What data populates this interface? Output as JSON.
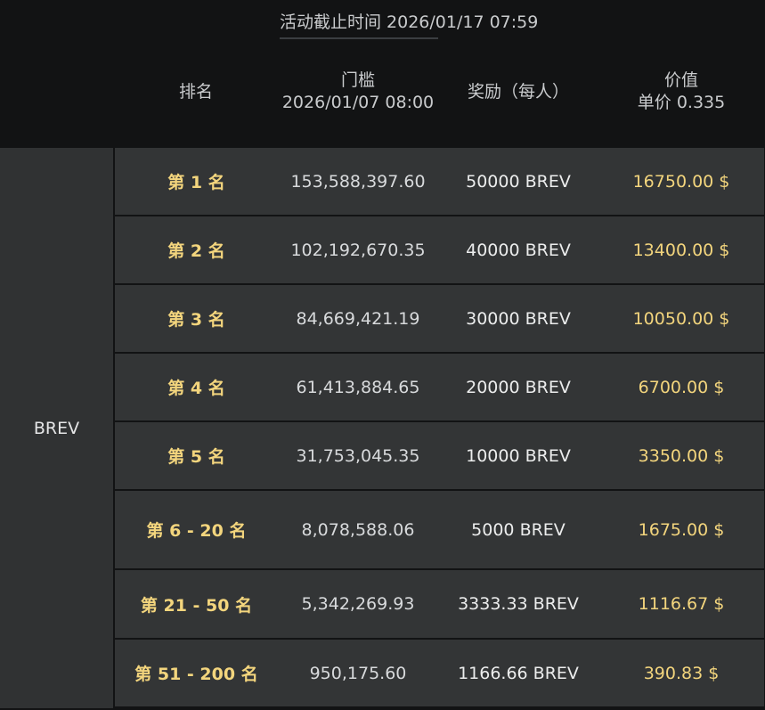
{
  "header": {
    "deadline": "活动截止时间 2026/01/17 07:59",
    "columns": {
      "rank": "排名",
      "threshold_line1": "门槛",
      "threshold_line2": "2026/01/07 08:00",
      "reward": "奖励（每人）",
      "value_line1": "价值",
      "value_line2": "单价 0.335"
    }
  },
  "token": "BREV",
  "rows": [
    {
      "rank": "第 1 名",
      "threshold": "153,588,397.60",
      "reward": "50000 BREV",
      "value": "16750.00 $"
    },
    {
      "rank": "第 2 名",
      "threshold": "102,192,670.35",
      "reward": "40000 BREV",
      "value": "13400.00 $"
    },
    {
      "rank": "第 3 名",
      "threshold": "84,669,421.19",
      "reward": "30000 BREV",
      "value": "10050.00 $"
    },
    {
      "rank": "第 4 名",
      "threshold": "61,413,884.65",
      "reward": "20000 BREV",
      "value": "6700.00 $"
    },
    {
      "rank": "第 5 名",
      "threshold": "31,753,045.35",
      "reward": "10000 BREV",
      "value": "3350.00 $"
    },
    {
      "rank": "第 6 - 20 名",
      "threshold": "8,078,588.06",
      "reward": "5000 BREV",
      "value": "1675.00 $"
    },
    {
      "rank": "第 21 - 50 名",
      "threshold": "5,342,269.93",
      "reward": "3333.33 BREV",
      "value": "1116.67 $"
    },
    {
      "rank": "第 51 - 200 名",
      "threshold": "950,175.60",
      "reward": "1166.66 BREV",
      "value": "390.83 $"
    }
  ],
  "colors": {
    "background": "#121314",
    "row_bg": "#333536",
    "gold": "#f3d57d",
    "text_light": "#d8dadc"
  }
}
